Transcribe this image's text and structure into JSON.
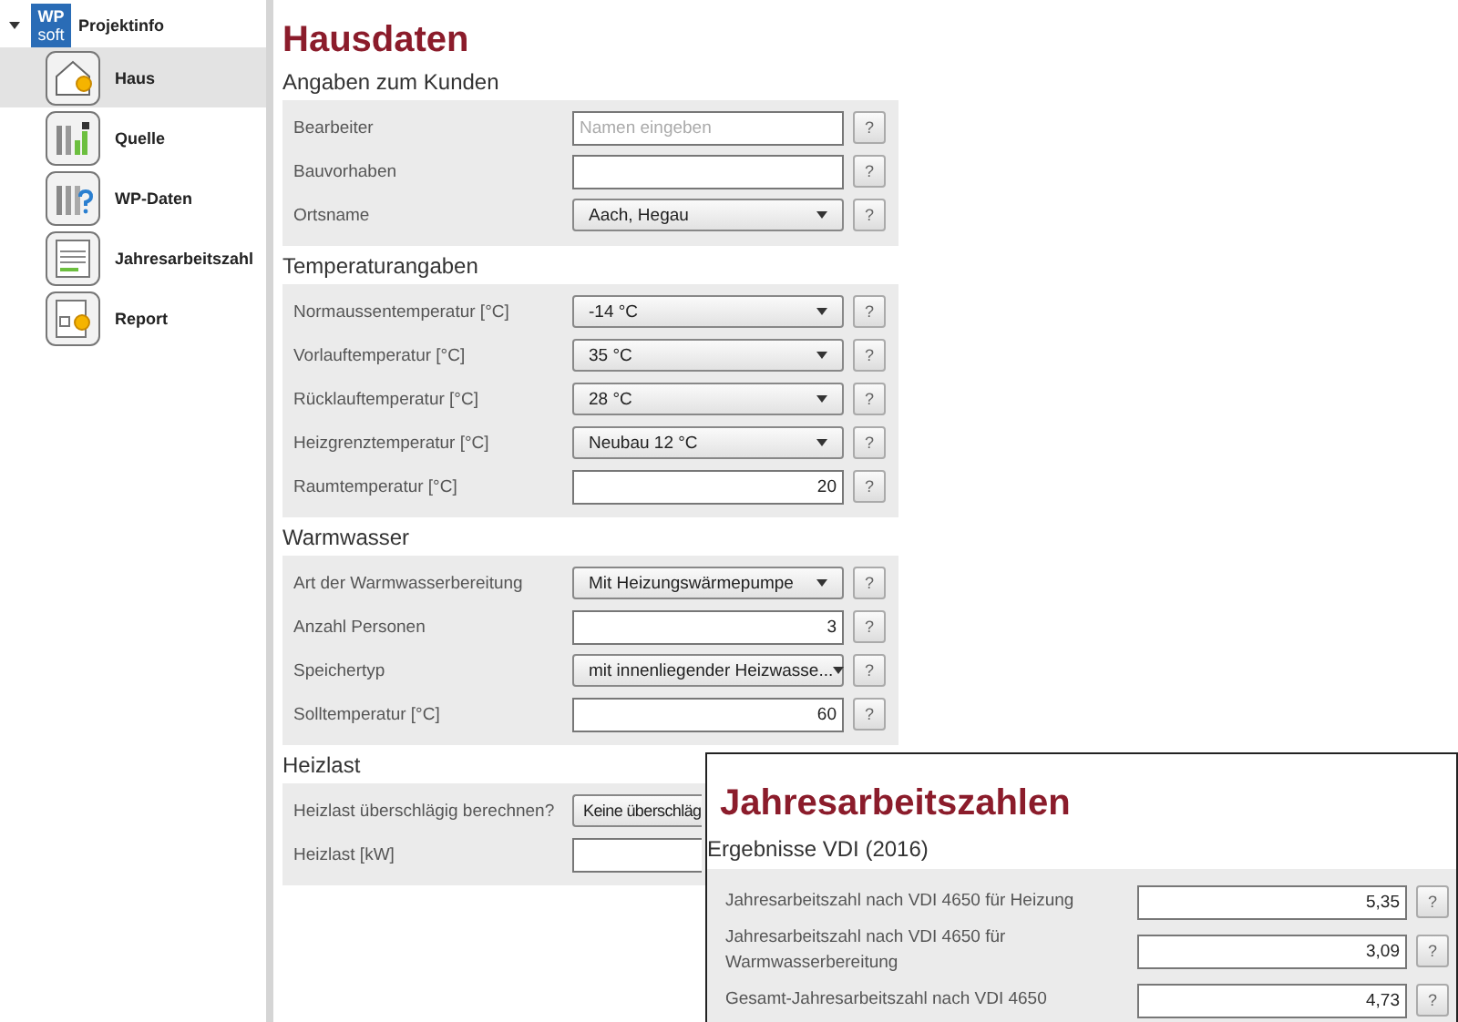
{
  "sidebar": {
    "logo": [
      "WP",
      "soft"
    ],
    "root": {
      "label": "Projektinfo",
      "expanded": true,
      "children": [
        {
          "label": "Haus",
          "selected": true
        },
        {
          "label": "Quelle",
          "selected": false
        },
        {
          "label": "WP-Daten",
          "selected": false
        },
        {
          "label": "Jahresarbeitszahl",
          "selected": false
        },
        {
          "label": "Report",
          "selected": false
        }
      ]
    }
  },
  "page": {
    "title": "Hausdaten",
    "sections": [
      {
        "heading": "Angaben zum Kunden",
        "rows": [
          {
            "label": "Bearbeiter",
            "kind": "text",
            "placeholder": "Namen eingeben",
            "help": "?"
          },
          {
            "label": "Bauvorhaben",
            "kind": "text",
            "help": "?"
          },
          {
            "label": "Ortsname",
            "kind": "select",
            "value": "Aach, Hegau",
            "help": "?"
          }
        ]
      },
      {
        "heading": "Temperaturangaben",
        "rows": [
          {
            "label": "Normaussentemperatur [°C]",
            "kind": "select",
            "value": "-14 °C",
            "help": "?"
          },
          {
            "label": "Vorlauftemperatur [°C]",
            "kind": "select",
            "value": "35 °C",
            "help": "?"
          },
          {
            "label": "Rücklauftemperatur [°C]",
            "kind": "select",
            "value": "28 °C",
            "help": "?"
          },
          {
            "label": "Heizgrenztemperatur [°C]",
            "kind": "select",
            "value": "Neubau 12 °C",
            "help": "?"
          },
          {
            "label": "Raumtemperatur [°C]",
            "kind": "number",
            "value": "20",
            "help": "?"
          }
        ]
      },
      {
        "heading": "Warmwasser",
        "rows": [
          {
            "label": "Art der Warmwasserbereitung",
            "kind": "select",
            "value": "Mit Heizungswärmepumpe",
            "help": "?"
          },
          {
            "label": "Anzahl Personen",
            "kind": "number",
            "value": "3",
            "help": "?"
          },
          {
            "label": "Speichertyp",
            "kind": "select",
            "value": "mit innenliegender Heizwasse...",
            "help": "?"
          },
          {
            "label": "Solltemperatur [°C]",
            "kind": "number",
            "value": "60",
            "help": "?"
          }
        ]
      },
      {
        "heading": "Heizlast",
        "rows": [
          {
            "label": "Heizlast überschlägig berechnen?",
            "kind": "select",
            "value": "Keine überschläg"
          },
          {
            "label": "Heizlast [kW]",
            "kind": "number"
          }
        ]
      }
    ]
  },
  "overlay": {
    "title": "Jahresarbeitszahlen",
    "heading": "Ergebnisse VDI (2016)",
    "rows": [
      {
        "label": "Jahresarbeitszahl nach VDI 4650 für Heizung",
        "kind": "number",
        "value": "5,35",
        "help": "?"
      },
      {
        "label": "Jahresarbeitszahl nach VDI 4650 für Warmwasserbereitung",
        "kind": "number",
        "value": "3,09",
        "help": "?"
      },
      {
        "label": "Gesamt-Jahresarbeitszahl nach VDI 4650",
        "kind": "number",
        "value": "4,73",
        "help": "?"
      }
    ]
  }
}
